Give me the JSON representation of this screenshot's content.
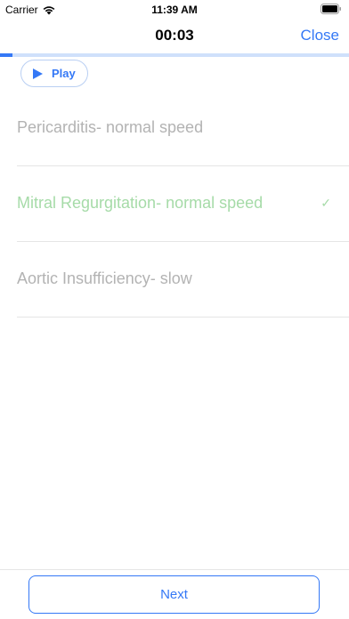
{
  "status_bar": {
    "carrier": "Carrier",
    "time": "11:39 AM"
  },
  "nav": {
    "timer": "00:03",
    "close_label": "Close"
  },
  "progress": {
    "fraction": 0.035
  },
  "player": {
    "play_label": "Play",
    "icon": "play-icon"
  },
  "options": [
    {
      "label": "Pericarditis- normal speed",
      "state": "disabled"
    },
    {
      "label": "Mitral Regurgitation- normal speed",
      "state": "correct",
      "icon": "checkmark-icon"
    },
    {
      "label": "Aortic Insufficiency- slow",
      "state": "disabled"
    }
  ],
  "footer": {
    "next_label": "Next"
  },
  "colors": {
    "accent": "#3478f6",
    "correct": "#a6dba8",
    "muted": "#b3b3b3"
  }
}
